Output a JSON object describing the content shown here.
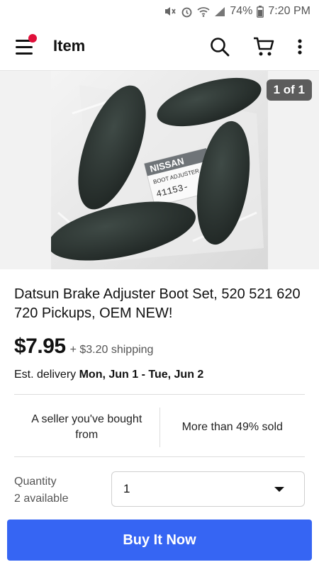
{
  "status_bar": {
    "battery": "74%",
    "time": "7:20 PM",
    "icons": [
      "mute-icon",
      "alarm-icon",
      "wifi-icon",
      "signal-icon",
      "battery-icon"
    ]
  },
  "app_bar": {
    "title": "Item",
    "icons": [
      "menu-icon",
      "search-icon",
      "cart-icon",
      "more-icon"
    ],
    "notification_color": "#e0103a"
  },
  "gallery": {
    "counter": "1 of 1",
    "package_text": [
      "NISSAN",
      "BOOT ADJUSTER",
      "41153-"
    ]
  },
  "item": {
    "title": "Datsun Brake Adjuster Boot Set, 520 521 620 720 Pickups, OEM NEW!",
    "price": "$7.95",
    "shipping": "+ $3.20 shipping",
    "delivery_label": "Est. delivery",
    "delivery_dates": "Mon, Jun 1 - Tue, Jun 2"
  },
  "facts": {
    "seller": "A seller you've bought from",
    "sold": "More than 49% sold"
  },
  "quantity": {
    "label": "Quantity",
    "available": "2 available",
    "selected": "1"
  },
  "actions": {
    "buy_now": "Buy It Now",
    "accent_color": "#3665f3"
  }
}
